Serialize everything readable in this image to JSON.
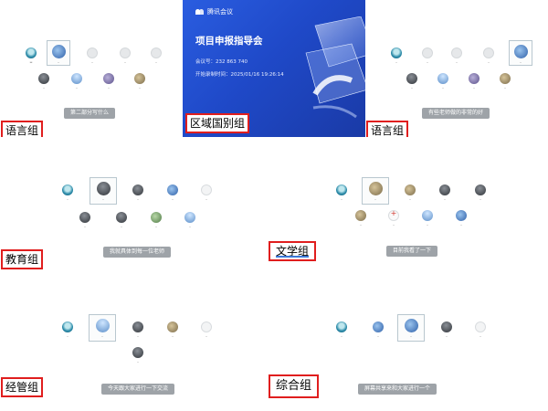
{
  "meeting": {
    "logo_text": "腾讯会议",
    "title": "项目申报指导会",
    "id_label": "会议号：",
    "id_value": "232 863 740",
    "record_label": "开始录制时间：",
    "record_value": "2025/01/16 19:26:14",
    "colors": {
      "card_start": "#2a5de0",
      "card_end": "#1a3aa6"
    }
  },
  "labels": {
    "p1": "语言组",
    "p2": "区域国别组",
    "p3": "语言组",
    "p4": "教育组",
    "p5": "文学组",
    "p6": "经管组",
    "p7": "综合组"
  },
  "chats": {
    "p1": "第二部分写什么",
    "p3": "有些老师做的非常的好",
    "p4": "我就具体到每一位老师",
    "p5": "目前我看了一下",
    "p6": "今天跟大家进行一下交流",
    "p7": "屏幕共享来和大家进行一个"
  },
  "accent_colors": {
    "red_box": "#e01e1e",
    "underline": "#3b78d6",
    "chat_bg": "#9ea3a8"
  }
}
